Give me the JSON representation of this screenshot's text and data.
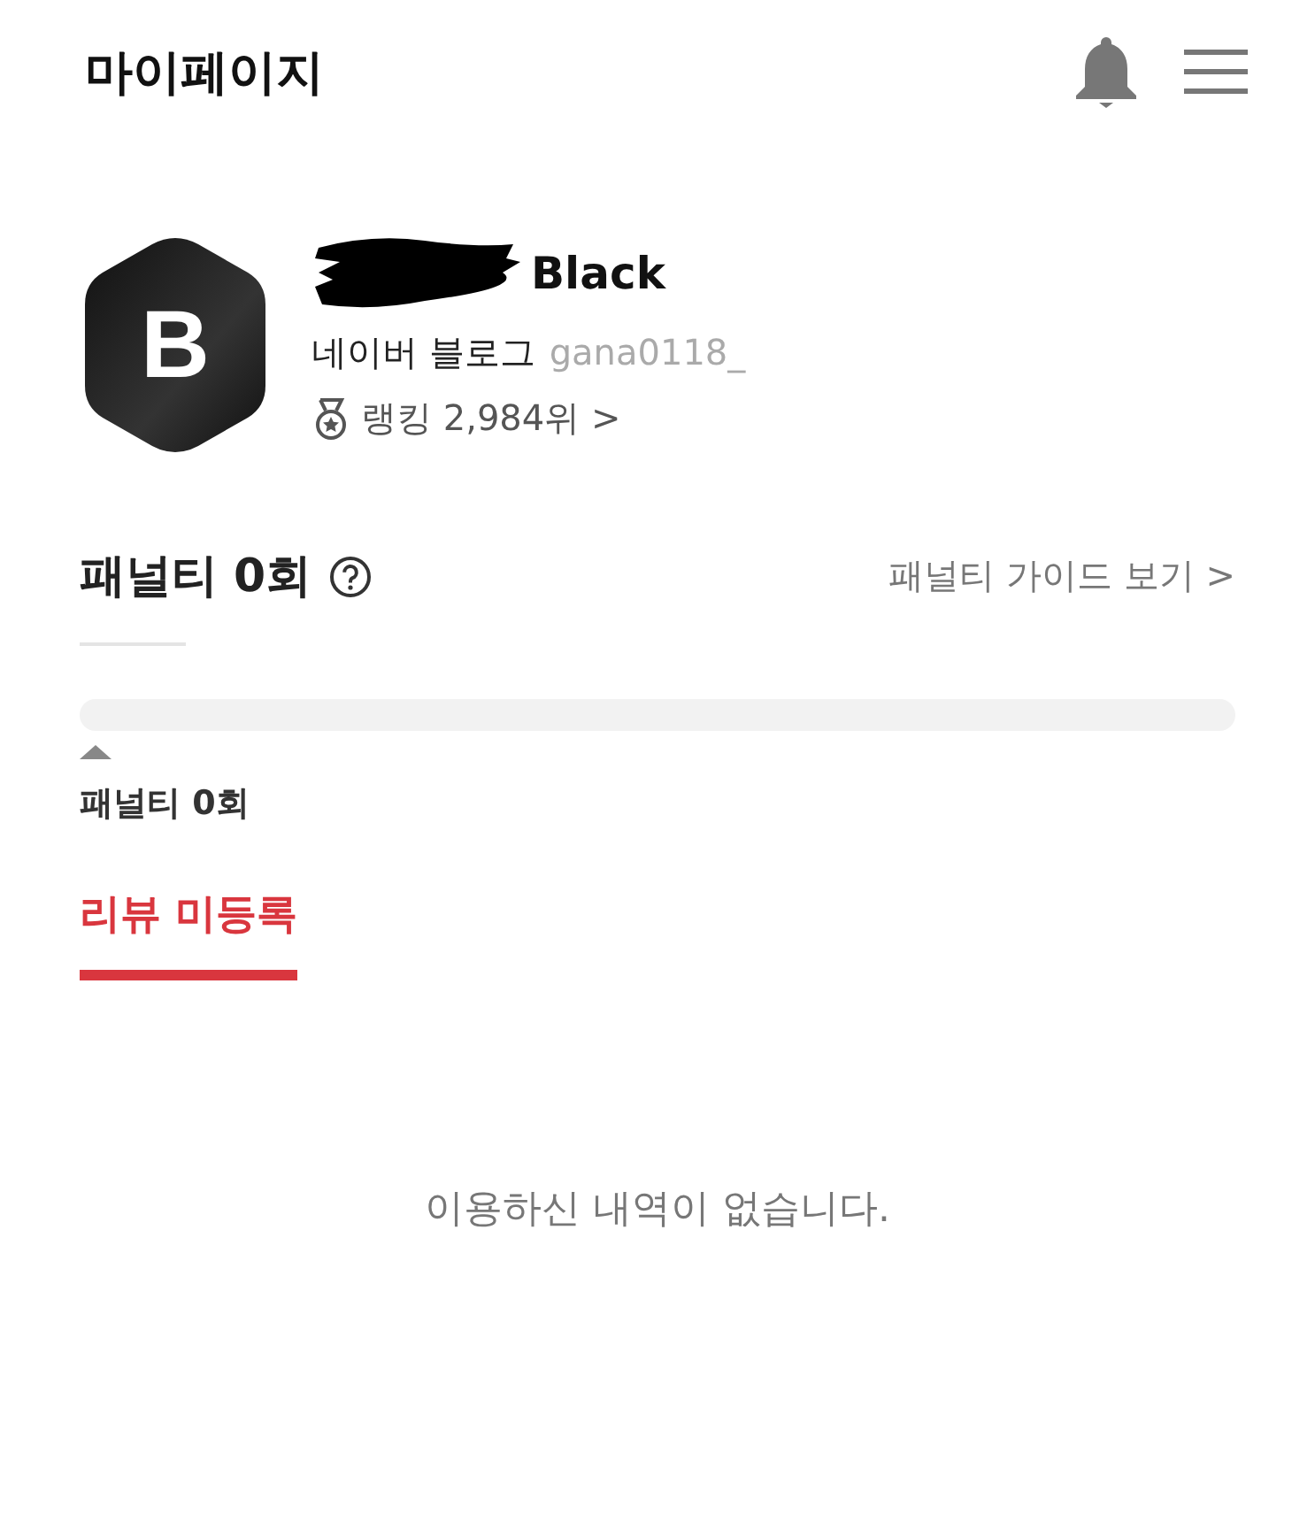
{
  "header": {
    "title": "마이페이지"
  },
  "profile": {
    "avatar_letter": "B",
    "name": "Black",
    "name_redacted": true,
    "blog": "네이버 블로그",
    "blog_id": "gana0118_",
    "ranking": "랭킹 2,984위 >"
  },
  "penalty": {
    "title": "패널티 0회",
    "guide_link": "패널티 가이드 보기 >",
    "label": "패널티 0회"
  },
  "tabs": [
    {
      "label": "리뷰 미등록",
      "selected": true
    }
  ],
  "empty_message": "이용하신 내역이 없습니다."
}
